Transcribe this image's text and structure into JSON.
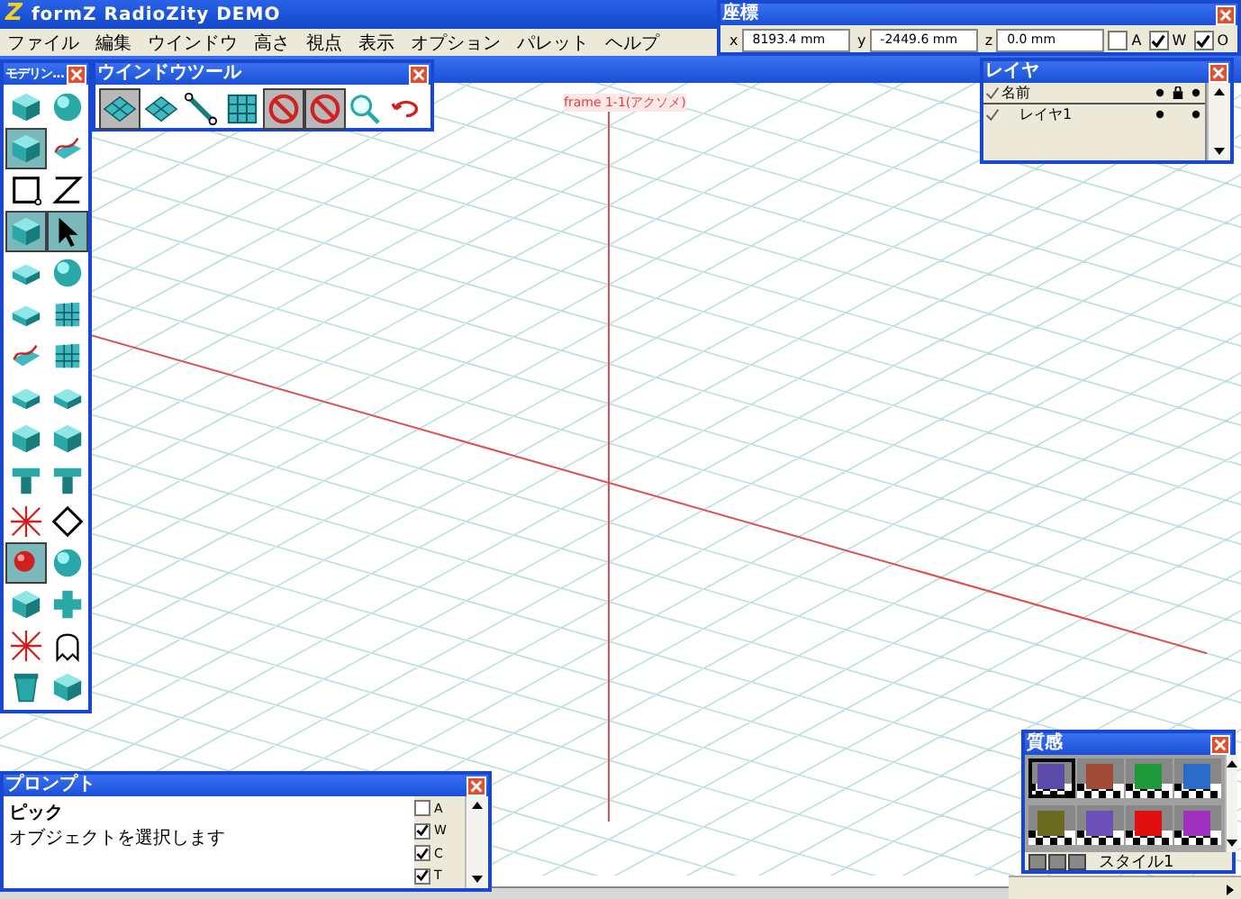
{
  "title": {
    "logo": "Z",
    "text": "formZ RadioZity DEMO"
  },
  "menu": [
    "ファイル",
    "編集",
    "ウインドウ",
    "高さ",
    "視点",
    "表示",
    "オプション",
    "パレット",
    "ヘルプ"
  ],
  "coordinates": {
    "title": "座標",
    "fields": [
      {
        "label": "x",
        "value": "8193.4 mm"
      },
      {
        "label": "y",
        "value": "-2449.6 mm"
      },
      {
        "label": "z",
        "value": "0.0 mm"
      }
    ],
    "toggles": [
      {
        "label": "A",
        "checked": false
      },
      {
        "label": "W",
        "checked": true
      },
      {
        "label": "O",
        "checked": true
      }
    ]
  },
  "modeling_tools": {
    "title": "モデリン...",
    "tools": [
      {
        "selected": false
      },
      {
        "selected": false
      },
      {
        "selected": true
      },
      {
        "selected": false
      },
      {
        "selected": false
      },
      {
        "selected": false
      },
      {
        "selected": true
      },
      {
        "selected": true
      },
      {
        "selected": false
      },
      {
        "selected": false
      },
      {
        "selected": false
      },
      {
        "selected": false
      },
      {
        "selected": false
      },
      {
        "selected": false
      },
      {
        "selected": false
      },
      {
        "selected": false
      },
      {
        "selected": false
      },
      {
        "selected": false
      },
      {
        "selected": false
      },
      {
        "selected": false
      },
      {
        "selected": false
      },
      {
        "selected": false
      },
      {
        "selected": true
      },
      {
        "selected": false
      },
      {
        "selected": false
      },
      {
        "selected": false
      },
      {
        "selected": false
      },
      {
        "selected": false
      },
      {
        "selected": false
      },
      {
        "selected": false
      }
    ]
  },
  "window_tools": {
    "title": "ウインドウツール",
    "tools": [
      {
        "selected": true
      },
      {
        "selected": false
      },
      {
        "selected": false
      },
      {
        "selected": false
      },
      {
        "selected": true
      },
      {
        "selected": true
      },
      {
        "selected": false
      },
      {
        "selected": false
      }
    ]
  },
  "layers": {
    "title": "レイヤ",
    "header": "名前",
    "rows": [
      {
        "name": "レイヤ1",
        "visible": true
      }
    ]
  },
  "viewport": {
    "frame_label": "frame 1-1(アクソメ)"
  },
  "prompt": {
    "title": "プロンプト",
    "heading": "ピック",
    "message": "オブジェクトを選択します",
    "toggles": [
      {
        "label": "A",
        "checked": false
      },
      {
        "label": "W",
        "checked": true
      },
      {
        "label": "C",
        "checked": true
      },
      {
        "label": "T",
        "checked": true
      }
    ]
  },
  "materials": {
    "title": "質感",
    "style": "スタイル1",
    "swatches": [
      {
        "color": "#5b4aa8",
        "selected": true
      },
      {
        "color": "#a04a38",
        "selected": false
      },
      {
        "color": "#1f9a3a",
        "selected": false
      },
      {
        "color": "#2a6cc8",
        "selected": false
      },
      {
        "color": "#6a6a20",
        "selected": false
      },
      {
        "color": "#6a50b8",
        "selected": false
      },
      {
        "color": "#e01010",
        "selected": false
      },
      {
        "color": "#a030c0",
        "selected": false
      }
    ]
  }
}
